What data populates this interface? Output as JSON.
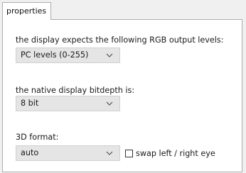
{
  "tab": {
    "label": "properties"
  },
  "rgb_levels": {
    "label": "the display expects the following RGB output levels:",
    "value": "PC levels (0-255)"
  },
  "bitdepth": {
    "label": "the native display bitdepth is:",
    "value": "8 bit"
  },
  "format_3d": {
    "label": "3D format:",
    "value": "auto"
  },
  "swap_eyes": {
    "label": "swap left / right eye",
    "checked": false
  }
}
